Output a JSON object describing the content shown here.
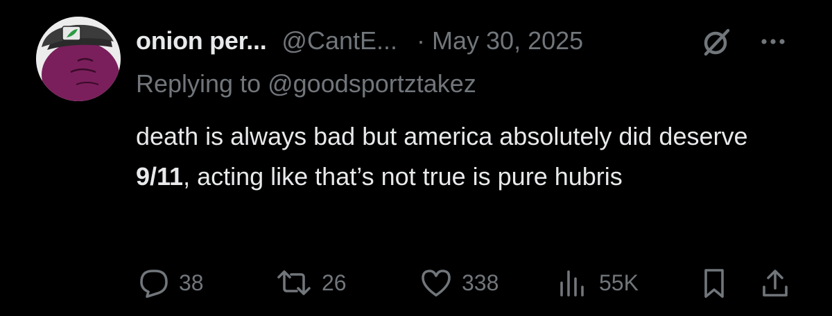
{
  "tweet": {
    "author": {
      "display_name": "onion per...",
      "handle": "@CantE...",
      "avatar_icon": "onion-avatar-icon"
    },
    "separator": "·",
    "date": "May 30, 2025",
    "replying_prefix": "Replying to ",
    "replying_handle": "@goodsportztakez",
    "text_part1": "death is always bad but america absolutely did deserve ",
    "text_bold": "9/11",
    "text_part2": ", acting like that’s not true is pure hubris"
  },
  "actions": {
    "replies": "38",
    "reposts": "26",
    "likes": "338",
    "views": "55K"
  },
  "colors": {
    "background": "#000000",
    "primary_text": "#e7e9ea",
    "secondary_text": "#71767b",
    "avatar_purple": "#7a1f5c"
  },
  "icons": {
    "grok": "grok-icon",
    "more": "more-icon",
    "reply": "reply-icon",
    "repost": "repost-icon",
    "like": "heart-icon",
    "views": "analytics-icon",
    "bookmark": "bookmark-icon",
    "share": "share-icon"
  }
}
